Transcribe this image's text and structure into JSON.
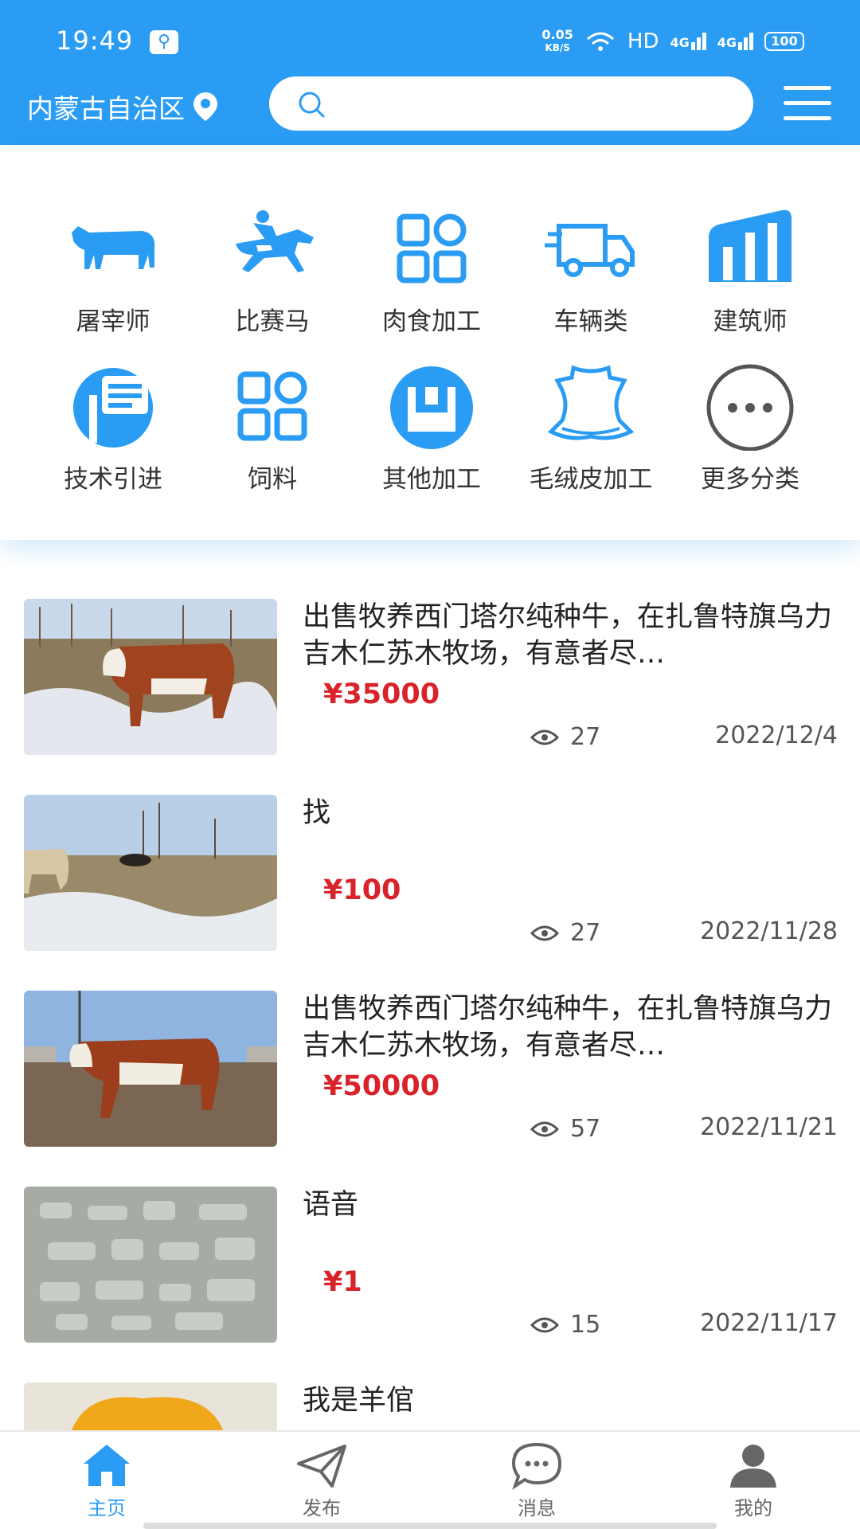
{
  "status_bar": {
    "time": "19:49",
    "net_speed_value": "0.05",
    "net_speed_unit": "KB/S",
    "hd": "HD",
    "signal1": "4G",
    "signal2": "4G",
    "battery": "100"
  },
  "header": {
    "location": "内蒙古自治区",
    "search_placeholder": ""
  },
  "categories": [
    {
      "label": "屠宰师",
      "icon": "cow-icon"
    },
    {
      "label": "比赛马",
      "icon": "racehorse-icon"
    },
    {
      "label": "肉食加工",
      "icon": "grid-icon"
    },
    {
      "label": "车辆类",
      "icon": "truck-icon"
    },
    {
      "label": "建筑师",
      "icon": "building-icon"
    },
    {
      "label": "技术引进",
      "icon": "tech-icon"
    },
    {
      "label": "饲料",
      "icon": "grid-icon"
    },
    {
      "label": "其他加工",
      "icon": "box-icon"
    },
    {
      "label": "毛绒皮加工",
      "icon": "hide-icon"
    },
    {
      "label": "更多分类",
      "icon": "more-icon"
    }
  ],
  "listings": [
    {
      "title": "出售牧养西门塔尔纯种牛，在扎鲁特旗乌力吉木仁苏木牧场，有意者尽…",
      "price": "¥35000",
      "views": "27",
      "date": "2022/12/4"
    },
    {
      "title": "找",
      "price": "¥100",
      "views": "27",
      "date": "2022/11/28"
    },
    {
      "title": "出售牧养西门塔尔纯种牛，在扎鲁特旗乌力吉木仁苏木牧场，有意者尽…",
      "price": "¥50000",
      "views": "57",
      "date": "2022/11/21"
    },
    {
      "title": "语音",
      "price": "¥1",
      "views": "15",
      "date": "2022/11/17"
    },
    {
      "title": "我是羊倌",
      "price": "",
      "views": "",
      "date": ""
    }
  ],
  "tabbar": {
    "home": "主页",
    "publish": "发布",
    "messages": "消息",
    "mine": "我的"
  },
  "colors": {
    "primary": "#2a9cf3",
    "price": "#d9232a"
  }
}
